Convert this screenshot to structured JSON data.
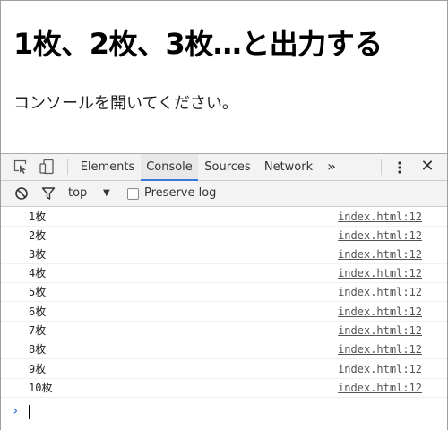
{
  "page": {
    "title": "1枚、2枚、3枚…と出力する",
    "instruction": "コンソールを開いてください。"
  },
  "devtools": {
    "tabs": [
      {
        "label": "Elements",
        "active": false
      },
      {
        "label": "Console",
        "active": true
      },
      {
        "label": "Sources",
        "active": false
      },
      {
        "label": "Network",
        "active": false
      }
    ],
    "more_tabs": "»",
    "close": "✕",
    "filter": {
      "context": "top",
      "context_arrow": "▼",
      "preserve_log_label": "Preserve log",
      "preserve_log_checked": false
    },
    "console": {
      "prompt": "›",
      "messages": [
        {
          "text": "1枚",
          "source": "index.html:12"
        },
        {
          "text": "2枚",
          "source": "index.html:12"
        },
        {
          "text": "3枚",
          "source": "index.html:12"
        },
        {
          "text": "4枚",
          "source": "index.html:12"
        },
        {
          "text": "5枚",
          "source": "index.html:12"
        },
        {
          "text": "6枚",
          "source": "index.html:12"
        },
        {
          "text": "7枚",
          "source": "index.html:12"
        },
        {
          "text": "8枚",
          "source": "index.html:12"
        },
        {
          "text": "9枚",
          "source": "index.html:12"
        },
        {
          "text": "10枚",
          "source": "index.html:12"
        }
      ]
    },
    "colors": {
      "accent": "#3879d9",
      "toolbar_bg": "#f3f3f3",
      "link": "#545454"
    }
  }
}
